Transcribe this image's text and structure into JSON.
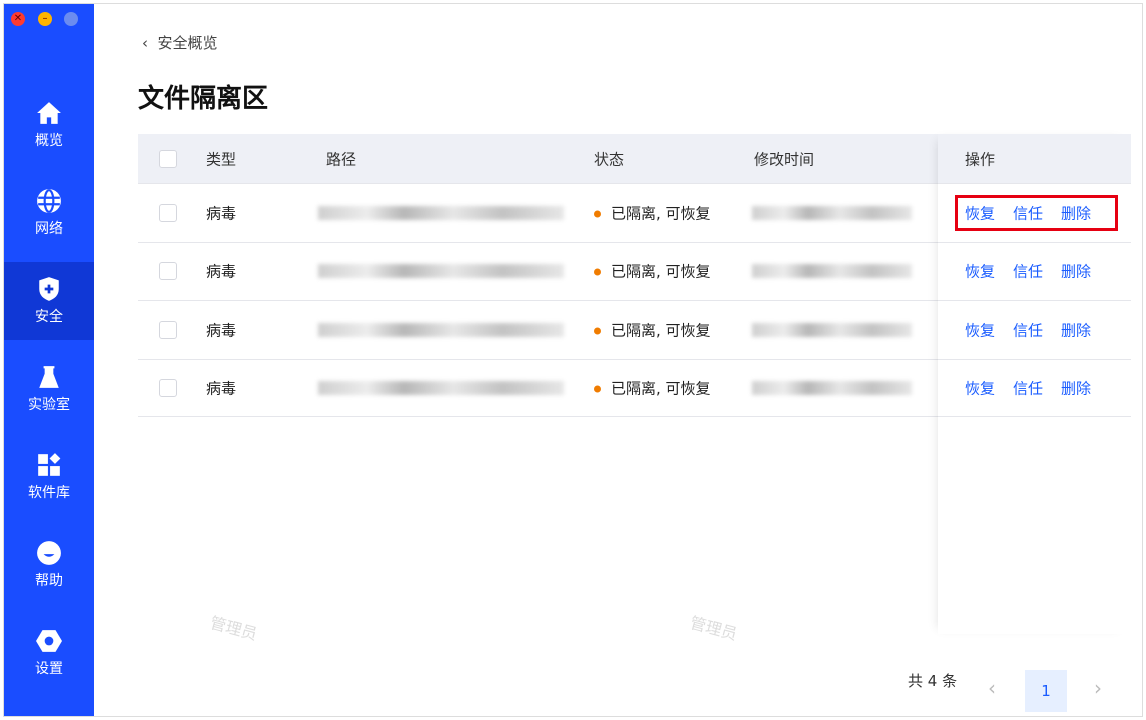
{
  "window": {
    "controls": [
      "close",
      "minimize",
      "zoom"
    ]
  },
  "sidebar": {
    "items": [
      {
        "label": "概览",
        "icon": "home-icon"
      },
      {
        "label": "网络",
        "icon": "globe-icon"
      },
      {
        "label": "安全",
        "icon": "shield-icon",
        "active": true
      },
      {
        "label": "实验室",
        "icon": "flask-icon"
      },
      {
        "label": "软件库",
        "icon": "apps-icon"
      },
      {
        "label": "帮助",
        "icon": "help-icon"
      },
      {
        "label": "设置",
        "icon": "gear-icon"
      }
    ]
  },
  "breadcrumb": {
    "back_label": "安全概览"
  },
  "page_title": "文件隔离区",
  "watermark": "管理员",
  "table": {
    "columns": [
      "类型",
      "路径",
      "状态",
      "修改时间",
      "操作"
    ],
    "rows": [
      {
        "type": "病毒",
        "status": "已隔离, 可恢复"
      },
      {
        "type": "病毒",
        "status": "已隔离, 可恢复"
      },
      {
        "type": "病毒",
        "status": "已隔离, 可恢复"
      },
      {
        "type": "病毒",
        "status": "已隔离, 可恢复"
      }
    ],
    "actions": {
      "restore": "恢复",
      "trust": "信任",
      "delete": "删除"
    }
  },
  "pagination": {
    "total_label": "共 4 条",
    "current_page": "1",
    "prev": "‹",
    "next": "›"
  },
  "colors": {
    "sidebar": "#1a4dff",
    "accent": "#1a5cff",
    "status_dot": "#f07c00",
    "highlight": "#e60012"
  }
}
